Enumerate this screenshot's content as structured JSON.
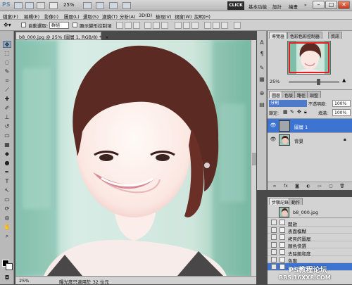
{
  "app_bar": {
    "logo": "PS",
    "zoom": "25%",
    "workspace_button": "CLICK",
    "workspaces": [
      "基本功能",
      "設計",
      "繪畫"
    ],
    "more": "»",
    "win_min": "–",
    "win_max": "□",
    "win_close": "✕"
  },
  "menu": [
    "檔案(F)",
    "編輯(E)",
    "影像(I)",
    "圖層(L)",
    "選取(S)",
    "濾鏡(T)",
    "分析(A)",
    "3D(D)",
    "檢視(V)",
    "視窗(W)",
    "說明(H)"
  ],
  "options_bar": {
    "auto_select_label": "自動選取:",
    "auto_select_value": "群組",
    "show_transform_label": "顯示變形控制項"
  },
  "document": {
    "tab_title": "b8_000.jpg @ 25% (圖層 1, RGB/8) *",
    "tab_close": "×",
    "status_zoom": "25%",
    "status_info": "曝光度只適用於 32 位元"
  },
  "navigator": {
    "tabs": [
      "導覽器",
      "色彩色彩控制器",
      "資訊"
    ],
    "zoom": "25%",
    "zoom_in": "▲"
  },
  "layers": {
    "tabs": [
      "圖層",
      "色版",
      "路徑",
      "調整"
    ],
    "blend_mode": "分割",
    "opacity_label": "不透明度:",
    "opacity": "100%",
    "lock_label": "鎖定:",
    "fill_label": "填滿:",
    "fill": "100%",
    "items": [
      {
        "name": "圖層 1",
        "selected": true
      },
      {
        "name": "背景",
        "selected": false,
        "locked": true
      }
    ]
  },
  "history": {
    "tabs": [
      "步驟記錄",
      "動作"
    ],
    "snapshot": "b8_000.jpg",
    "steps": [
      {
        "label": "開啟",
        "selected": false
      },
      {
        "label": "表面模糊",
        "selected": false
      },
      {
        "label": "拷貝的圖層",
        "selected": false
      },
      {
        "label": "顏色快選",
        "selected": false
      },
      {
        "label": "去除飽和度",
        "selected": false
      },
      {
        "label": "色階",
        "selected": false
      },
      {
        "label": "混合模式",
        "selected": true
      }
    ]
  },
  "watermark": {
    "line1": "PS教程论坛",
    "line2": "BBS.16XX8.COM"
  },
  "colors": {
    "accent": "#3d74d1",
    "close_red": "#c2391a",
    "panel": "#d3d3d3"
  }
}
